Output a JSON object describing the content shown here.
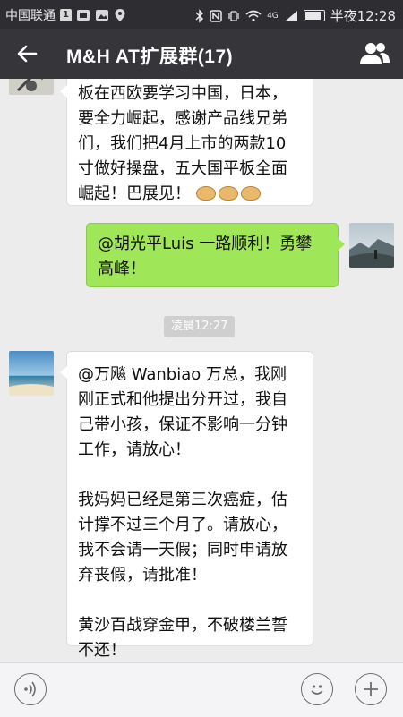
{
  "status_bar": {
    "carrier": "中国联通",
    "signal_badge": "1",
    "network_badge": "4G",
    "time": "半夜12:28"
  },
  "header": {
    "title": "M&H AT扩展群(17)",
    "icons": [
      "back-arrow-icon",
      "group-members-icon"
    ]
  },
  "messages": [
    {
      "side": "left",
      "lines": [
        "板在西欧要学习中国，日本，要全力崛起，感谢产品线兄弟们，我们把4月上市的两款10寸做好操盘，五大国平板全面崛起！巴展见！"
      ]
    },
    {
      "side": "right",
      "lines": [
        "@胡光平Luis 一路顺利！勇攀高峰！"
      ]
    },
    {
      "timestamp": "凌晨12:27"
    },
    {
      "side": "left",
      "paragraphs": [
        "@万飚 Wanbiao 万总，我刚刚正式和他提出分开过，我自己带小孩，保证不影响一分钟工作，请放心！",
        "我妈妈已经是第三次癌症，估计撑不过三个月了。请放心，我不会请一天假；同时申请放弃丧假，请批准！",
        "黄沙百战穿金甲，不破楼兰誓不还！"
      ]
    }
  ],
  "input_bar": {
    "icons": [
      "voice-icon",
      "emoji-icon",
      "plus-icon"
    ]
  },
  "colors": {
    "header_bg": "#36363a",
    "chat_bg": "#ececec",
    "own_bubble": "#9fe658",
    "other_bubble": "#ffffff"
  }
}
